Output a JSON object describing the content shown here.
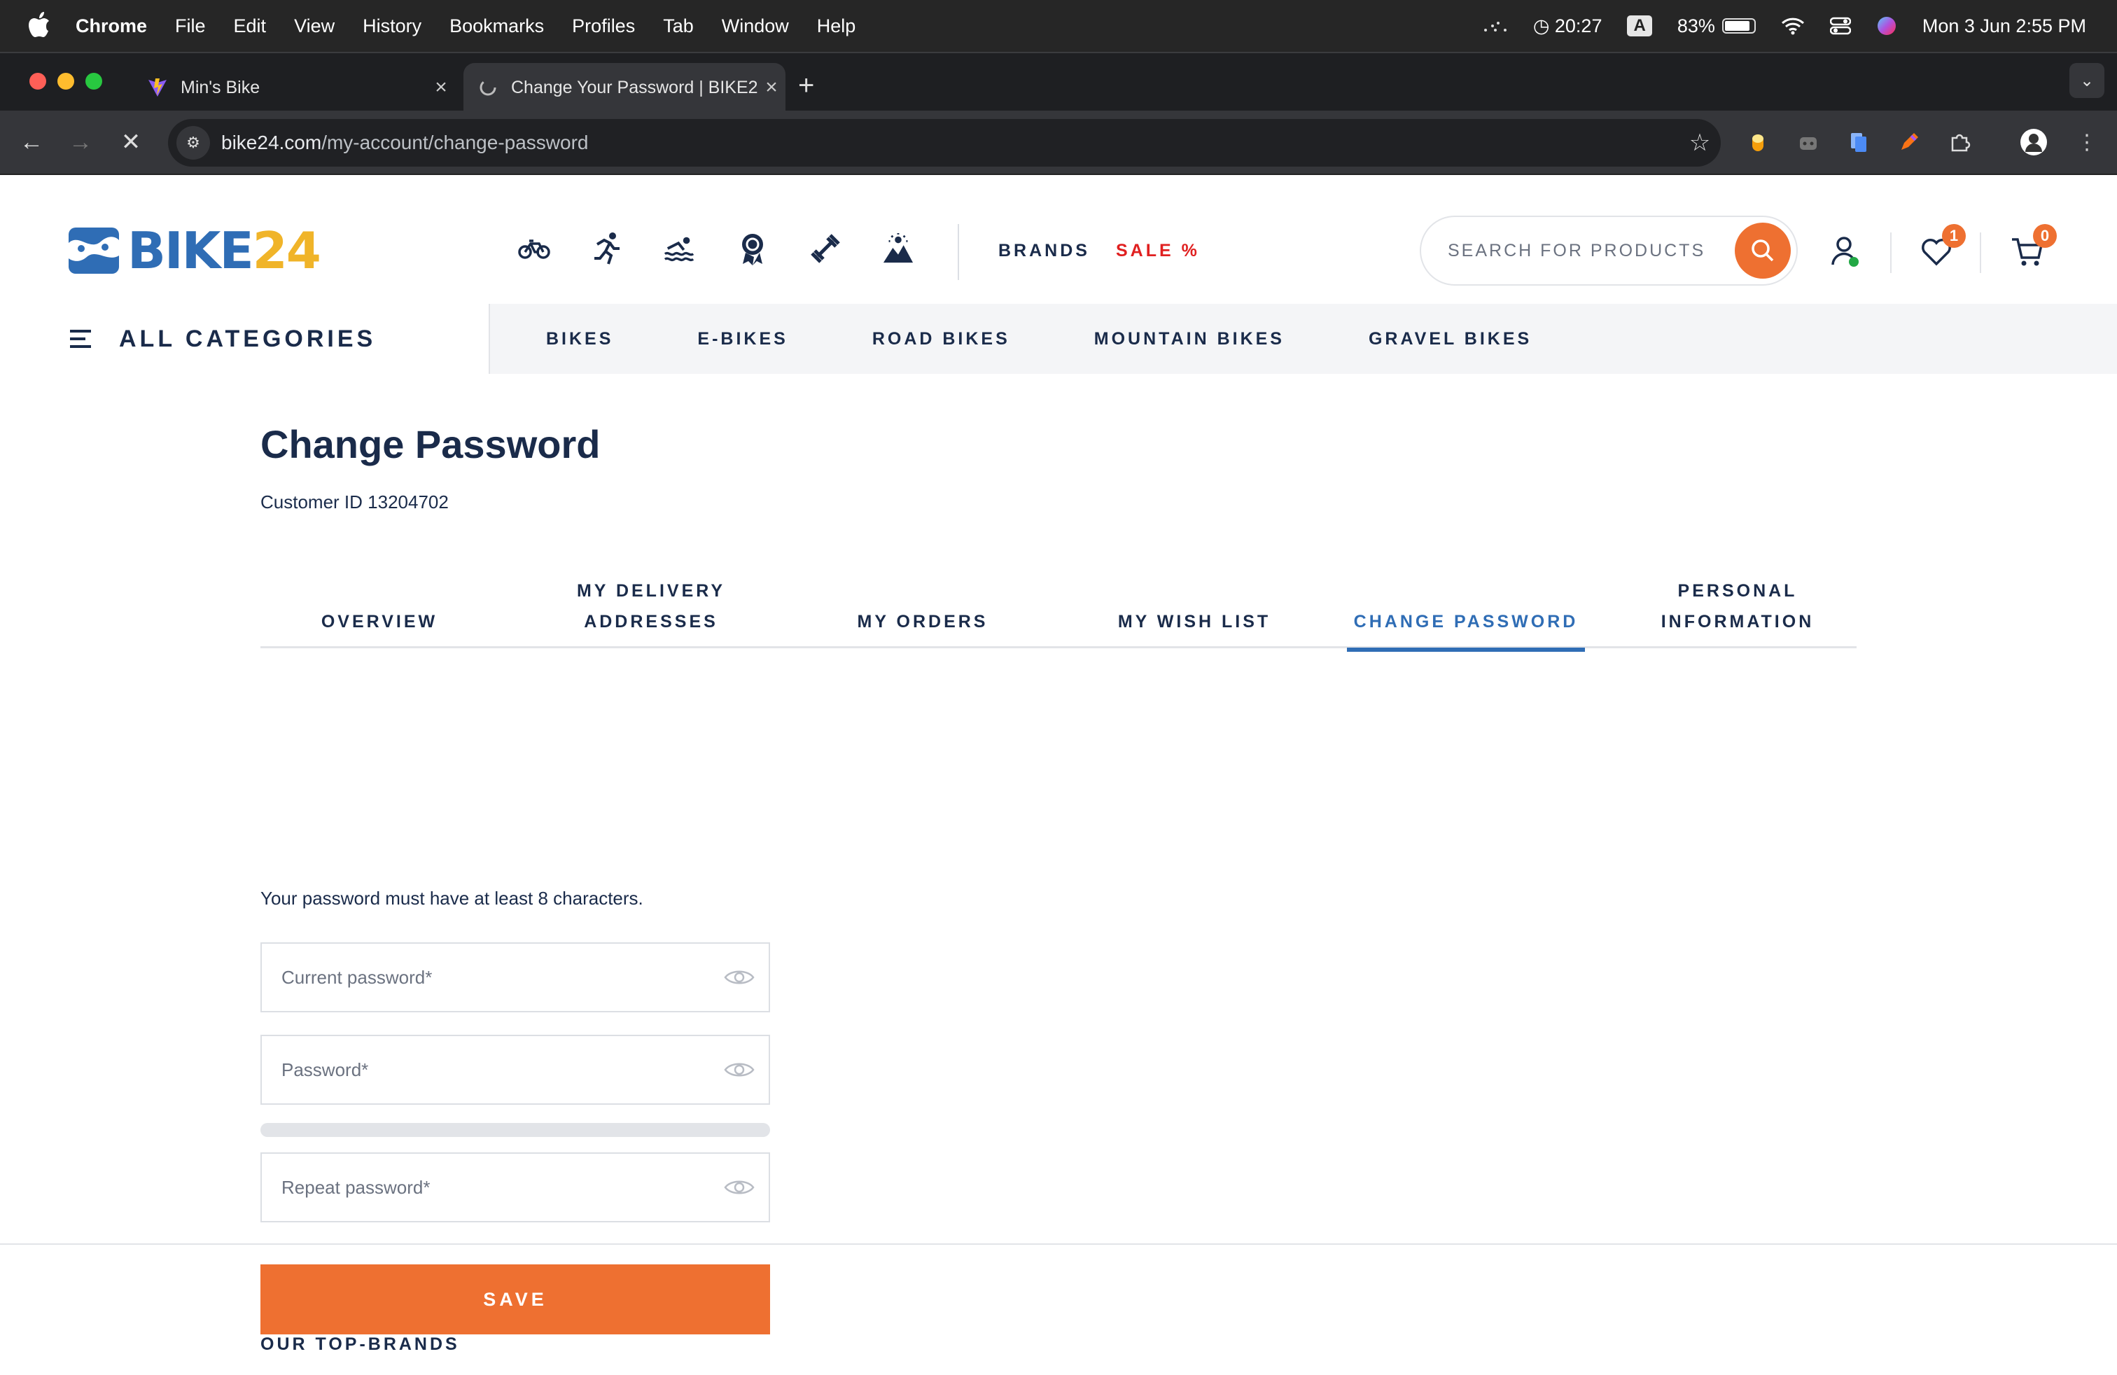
{
  "menubar": {
    "app": "Chrome",
    "menus": [
      "File",
      "Edit",
      "View",
      "History",
      "Bookmarks",
      "Profiles",
      "Tab",
      "Window",
      "Help"
    ],
    "timer": "20:27",
    "input_source": "A",
    "battery": "83%",
    "datetime": "Mon 3 Jun  2:55 PM"
  },
  "browser": {
    "tabs": [
      {
        "title": "Min's Bike"
      },
      {
        "title": "Change Your Password | BIKE24"
      }
    ],
    "url_host": "bike24.com",
    "url_path": "/my-account/change-password"
  },
  "header": {
    "logo_text_a": "BIKE",
    "logo_text_b": "24",
    "brands": "BRANDS",
    "sale": "SALE %",
    "search_placeholder": "SEARCH FOR PRODUCTS",
    "wishlist_count": "1",
    "cart_count": "0"
  },
  "catnav": {
    "all_categories": "ALL CATEGORIES",
    "links": [
      "BIKES",
      "E-BIKES",
      "ROAD BIKES",
      "MOUNTAIN BIKES",
      "GRAVEL BIKES"
    ]
  },
  "page": {
    "title": "Change Password",
    "customer_id": "Customer ID 13204702",
    "tabs": [
      "OVERVIEW",
      "MY DELIVERY ADDRESSES",
      "MY ORDERS",
      "MY WISH LIST",
      "CHANGE PASSWORD",
      "PERSONAL INFORMATION"
    ],
    "active_tab": "CHANGE PASSWORD",
    "hint": "Your password must have at least 8 characters.",
    "current_password_placeholder": "Current password*",
    "password_placeholder": "Password*",
    "repeat_password_placeholder": "Repeat password*",
    "save_label": "SAVE",
    "top_brands": "OUR TOP-BRANDS"
  },
  "colors": {
    "brand_blue": "#2f6db5",
    "brand_yellow": "#f0b429",
    "accent_orange": "#ee7031",
    "sale_red": "#e02020",
    "text_navy": "#1a2b4a"
  }
}
